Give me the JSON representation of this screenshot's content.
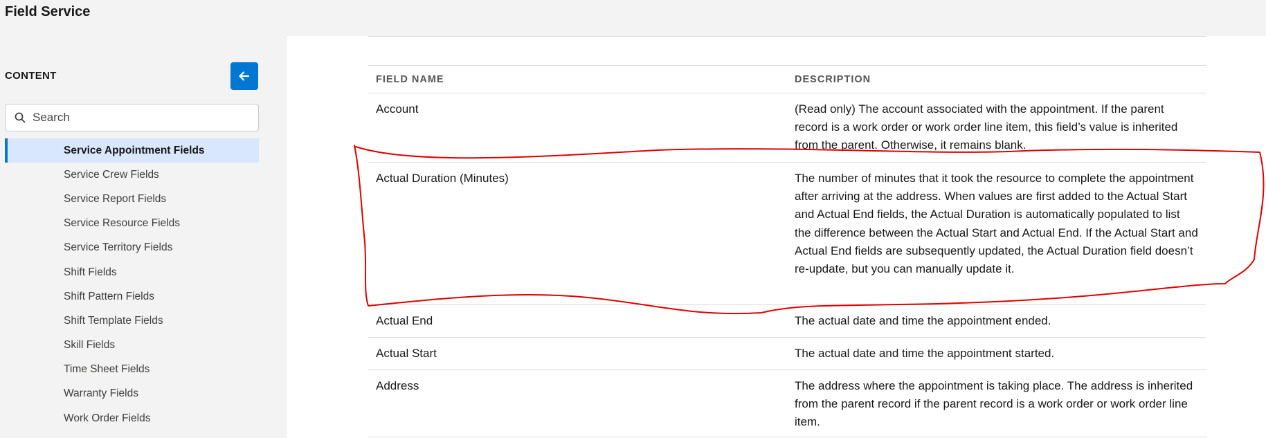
{
  "header": {
    "title": "Field Service"
  },
  "sidebar": {
    "content_label": "CONTENT",
    "search_placeholder": "Search",
    "items": [
      {
        "label": "Service Appointment Fields",
        "active": true
      },
      {
        "label": "Service Crew Fields"
      },
      {
        "label": "Service Report Fields"
      },
      {
        "label": "Service Resource Fields"
      },
      {
        "label": "Service Territory Fields"
      },
      {
        "label": "Shift Fields"
      },
      {
        "label": "Shift Pattern Fields"
      },
      {
        "label": "Shift Template Fields"
      },
      {
        "label": "Skill Fields"
      },
      {
        "label": "Time Sheet Fields"
      },
      {
        "label": "Warranty Fields"
      },
      {
        "label": "Work Order Fields"
      }
    ]
  },
  "table": {
    "headers": {
      "field_name": "FIELD NAME",
      "description": "DESCRIPTION"
    },
    "rows": [
      {
        "name": "Account",
        "description": "(Read only) The account associated with the appointment. If the parent record is a work order or work order line item, this field’s value is inherited from the parent. Otherwise, it remains blank."
      },
      {
        "name": "Actual Duration (Minutes)",
        "description": "The number of minutes that it took the resource to complete the appointment after arriving at the address. When values are first added to the Actual Start and Actual End fields, the Actual Duration is automatically populated to list the difference between the Actual Start and Actual End. If the Actual Start and Actual End fields are subsequently updated, the Actual Duration field doesn’t re-update, but you can manually update it."
      },
      {
        "name": "Actual End",
        "description": "The actual date and time the appointment ended."
      },
      {
        "name": "Actual Start",
        "description": "The actual date and time the appointment started."
      },
      {
        "name": "Address",
        "description": "The address where the appointment is taking place. The address is inherited from the parent record if the parent record is a work order or work order line item."
      }
    ]
  },
  "colors": {
    "accent": "#0176d3",
    "annotation": "#e00000",
    "active_bg": "#d8e6fe"
  },
  "icons": {
    "back": "arrow-left-icon",
    "search": "search-icon"
  }
}
